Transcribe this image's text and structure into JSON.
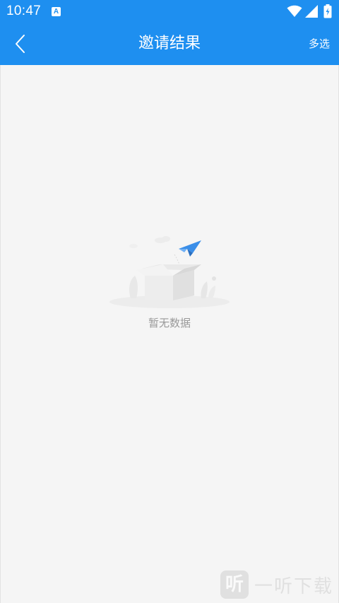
{
  "status_bar": {
    "time": "10:47",
    "notification_icon": "A"
  },
  "header": {
    "title": "邀请结果",
    "back_icon": "chevron-left-icon",
    "multi_select_label": "多选",
    "background_color": "#1e8ff0"
  },
  "empty_state": {
    "illustration": "empty-box-paper-plane",
    "message": "暂无数据"
  },
  "watermark": {
    "logo_char": "听",
    "text": "一听下载"
  }
}
